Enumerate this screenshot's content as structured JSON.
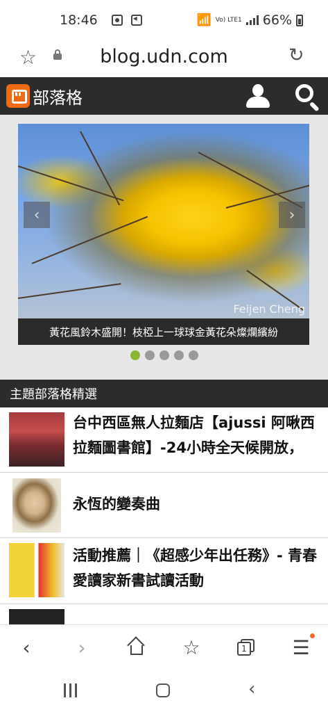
{
  "status_bar": {
    "time": "18:46",
    "network": "Vo) LTE1",
    "battery": "66%"
  },
  "browser": {
    "url": "blog.udn.com"
  },
  "site": {
    "brand": "部落格",
    "brand_color": "#ee6b14"
  },
  "carousel": {
    "watermark": "Feijen Cheng",
    "caption": "黃花風鈴木盛開！枝椏上一球球金黃花朵燦爛繽紛",
    "slide_count": 5,
    "active_index": 0,
    "active_dot_color": "#8ab733"
  },
  "section": {
    "title": "主題部落格精選"
  },
  "articles": [
    {
      "title": "台中西區無人拉麵店【ajussi 阿啾西拉麵圖書館】-24小時全天候開放，"
    },
    {
      "title": "永恆的變奏曲"
    },
    {
      "title": "活動推薦｜《超感少年出任務》- 青春愛讀家新書試讀活動"
    },
    {
      "title": ""
    }
  ],
  "bottom_nav": {
    "tab_count": "1",
    "icons": [
      "back-icon",
      "forward-icon",
      "home-icon",
      "bookmarks-icon",
      "tabs-icon",
      "menu-icon"
    ]
  },
  "system_nav": {
    "icons": [
      "recents-icon",
      "home-button-icon",
      "system-back-icon"
    ]
  }
}
